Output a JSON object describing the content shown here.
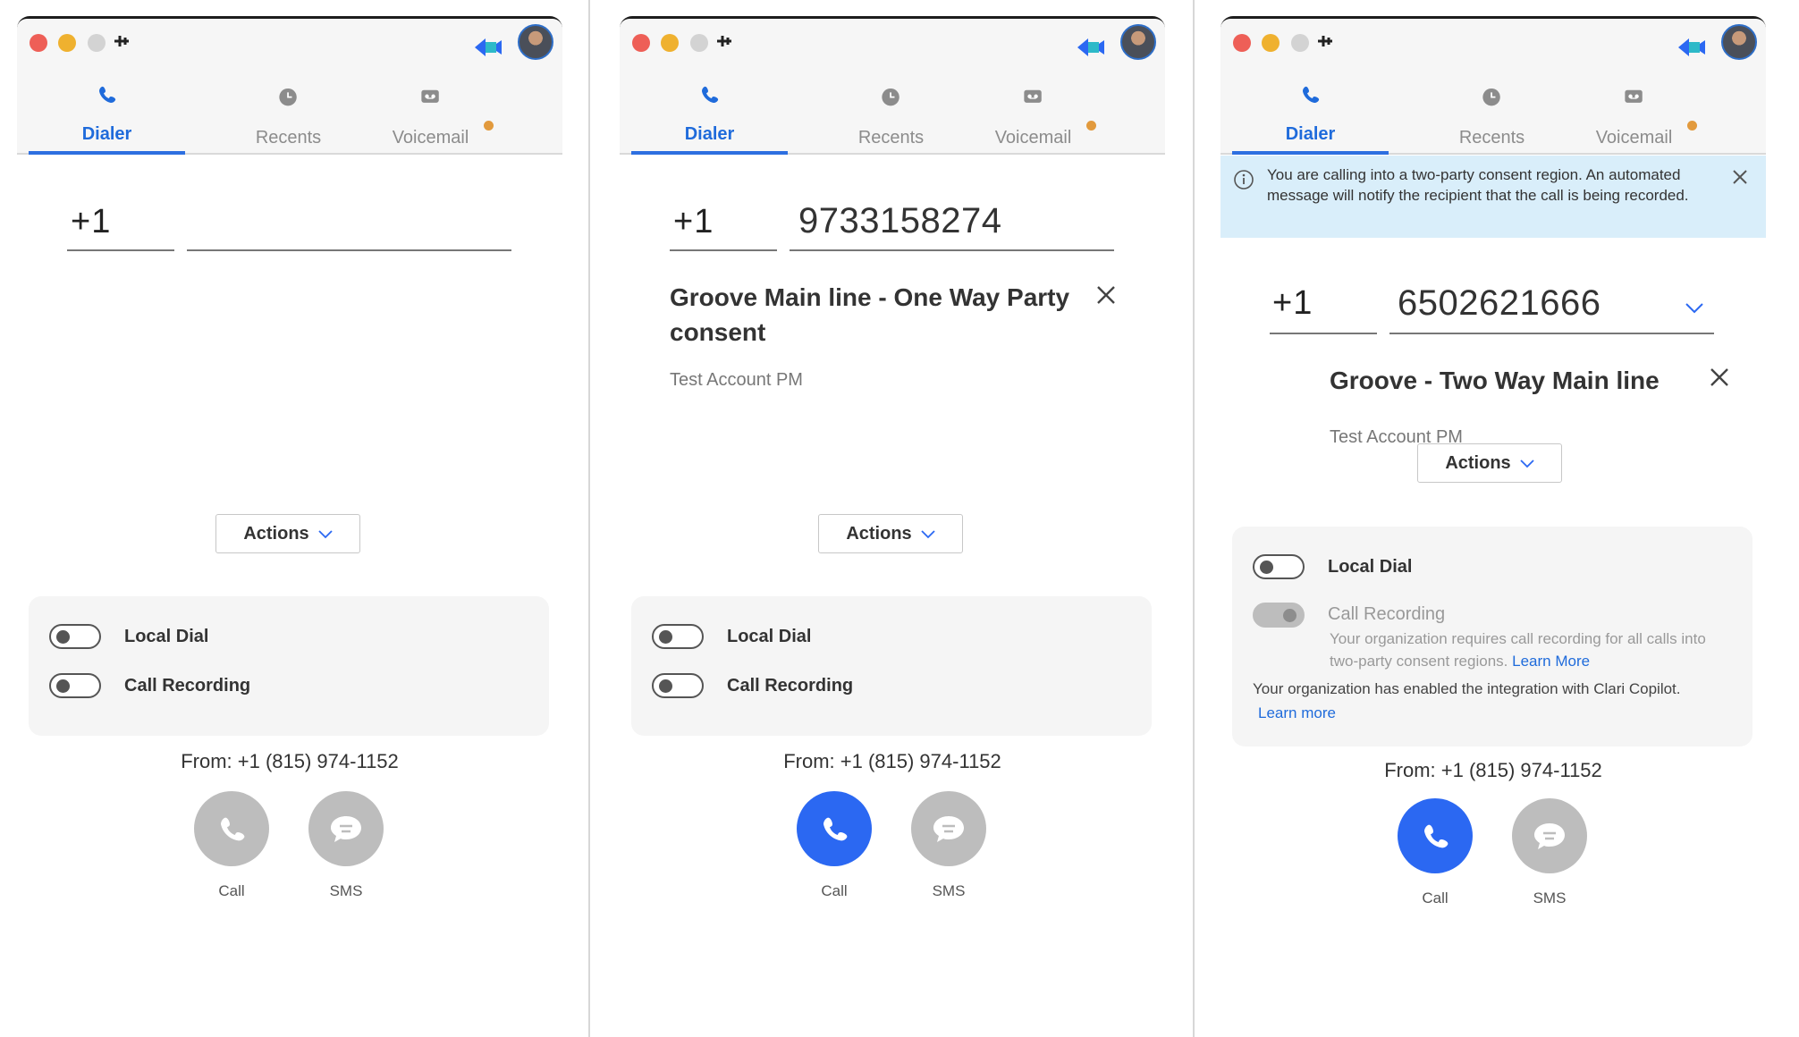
{
  "panels": [
    {
      "tabs": {
        "dialer": "Dialer",
        "recents": "Recents",
        "voicemail": "Voicemail"
      },
      "phone": {
        "country_code": "+1",
        "number": ""
      },
      "actions_label": "Actions",
      "options": {
        "local_dial": "Local Dial",
        "call_recording": "Call Recording"
      },
      "from": "From: +1 (815) 974-1152",
      "call_label": "Call",
      "sms_label": "SMS"
    },
    {
      "tabs": {
        "dialer": "Dialer",
        "recents": "Recents",
        "voicemail": "Voicemail"
      },
      "phone": {
        "country_code": "+1",
        "number": "9733158274"
      },
      "contact": {
        "name": "Groove Main line - One Way Party consent",
        "account": "Test Account PM"
      },
      "actions_label": "Actions",
      "options": {
        "local_dial": "Local Dial",
        "call_recording": "Call Recording"
      },
      "from": "From: +1 (815) 974-1152",
      "call_label": "Call",
      "sms_label": "SMS"
    },
    {
      "tabs": {
        "dialer": "Dialer",
        "recents": "Recents",
        "voicemail": "Voicemail"
      },
      "banner": "You are calling into a two-party consent region. An automated message will notify the recipient that the call is being recorded.",
      "phone": {
        "country_code": "+1",
        "number": "6502621666"
      },
      "contact": {
        "name": "Groove - Two Way Main line",
        "account": "Test Account PM"
      },
      "actions_label": "Actions",
      "options": {
        "local_dial": "Local Dial",
        "call_recording": "Call Recording"
      },
      "recording_note": "Your organization requires call recording for all calls into two-party consent regions.",
      "recording_link": "Learn More",
      "copilot_note": "Your organization has enabled the integration with Clari Copilot.",
      "copilot_link": "Learn more",
      "from": "From: +1 (815) 974-1152",
      "call_label": "Call",
      "sms_label": "SMS"
    }
  ],
  "colors": {
    "accent": "#2b68f2",
    "tab_active": "#1f6bdb",
    "voicemail_dot": "#e29a3d",
    "banner_bg": "#d9eefa"
  },
  "icons": [
    "pin-icon",
    "groove-logo-icon",
    "phone-icon",
    "clock-icon",
    "voicemail-icon",
    "close-icon",
    "chevron-down-icon",
    "info-icon",
    "chat-icon"
  ]
}
